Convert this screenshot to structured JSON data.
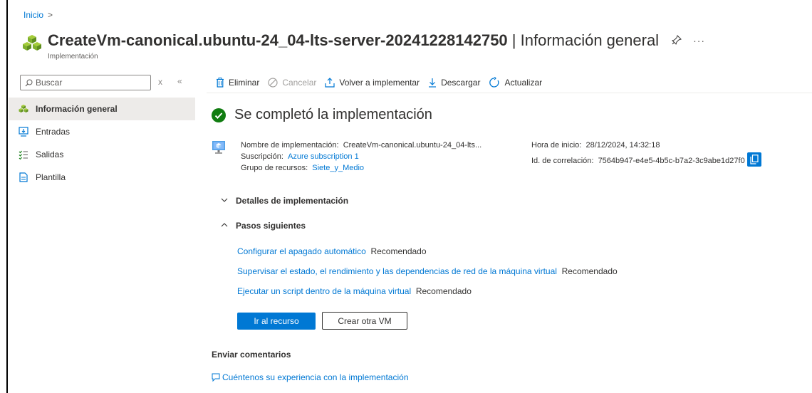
{
  "breadcrumb": {
    "home": "Inicio",
    "separator": ">"
  },
  "header": {
    "title": "CreateVm-canonical.ubuntu-24_04-lts-server-20241228142750",
    "title_separator": " | ",
    "title_section": "Información general",
    "subtitle": "Implementación",
    "pin_icon": "pin-icon",
    "more": "···"
  },
  "nav": {
    "search_placeholder": "Buscar",
    "clear": "x",
    "collapse": "«",
    "items": [
      {
        "label": "Información general",
        "icon": "overview-icon",
        "active": true
      },
      {
        "label": "Entradas",
        "icon": "inputs-icon"
      },
      {
        "label": "Salidas",
        "icon": "outputs-icon"
      },
      {
        "label": "Plantilla",
        "icon": "template-icon"
      }
    ]
  },
  "toolbar": {
    "delete": "Eliminar",
    "cancel": "Cancelar",
    "redeploy": "Volver a implementar",
    "download": "Descargar",
    "refresh": "Actualizar"
  },
  "status": {
    "text": "Se completó la implementación",
    "color": "#107c10"
  },
  "details": {
    "name_label": "Nombre de implementación:",
    "name_value": "CreateVm-canonical.ubuntu-24_04-lts...",
    "subscription_label": "Suscripción:",
    "subscription_value": "Azure subscription 1",
    "rg_label": "Grupo de recursos:",
    "rg_value": "Siete_y_Medio",
    "start_label": "Hora de inicio:",
    "start_value": "28/12/2024, 14:32:18",
    "corr_label": "Id. de correlación:",
    "corr_value": "7564b947-e4e5-4b5c-b7a2-3c9abe1d27f0"
  },
  "sections": {
    "deployment_details": "Detalles de implementación",
    "next_steps": "Pasos siguientes"
  },
  "next_steps": [
    {
      "link": "Configurar el apagado automático",
      "tag": "Recomendado"
    },
    {
      "link": "Supervisar el estado, el rendimiento y las dependencias de red de la máquina virtual",
      "tag": "Recomendado"
    },
    {
      "link": "Ejecutar un script dentro de la máquina virtual",
      "tag": "Recomendado"
    }
  ],
  "buttons": {
    "go_resource": "Ir al recurso",
    "create_vm": "Crear otra VM"
  },
  "feedback": {
    "heading": "Enviar comentarios",
    "link": "Cuéntenos su experiencia con la implementación"
  },
  "colors": {
    "accent": "#0078d4",
    "success": "#107c10",
    "text": "#323130"
  }
}
